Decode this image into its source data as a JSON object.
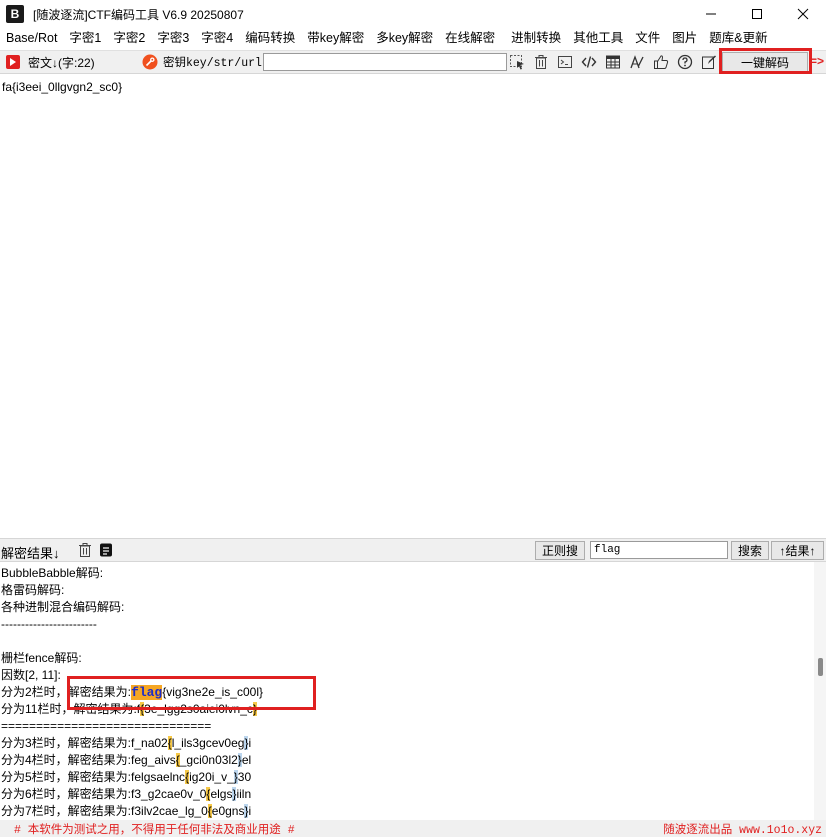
{
  "window": {
    "logo": "B",
    "title": "[随波逐流]CTF编码工具 V6.9  20250807"
  },
  "menu": [
    "Base/Rot",
    "字密1",
    "字密2",
    "字密3",
    "字密4",
    "编码转换",
    "带key解密",
    "多key解密",
    "在线解密",
    "进制转换",
    "其他工具",
    "文件",
    "图片",
    "题库&更新"
  ],
  "toolbar": {
    "cipher_label": "密文↓(字:22)",
    "key_label": "密钥key/str/url:",
    "key_value": "",
    "decode_button": "一键解码",
    "arrow_tag": "=>"
  },
  "input": {
    "text": "fa{i3eei_0llgvgn2_sc0}"
  },
  "resultbar": {
    "label": "解密结果↓",
    "regex_button": "正则搜",
    "search_value": "flag",
    "search_button": "搜索",
    "result_up_button": "↑结果↑"
  },
  "output": {
    "lines": [
      "BubbleBabble解码:",
      "格雷码解码:",
      "各种进制混合编码解码:",
      "------------------------",
      "",
      "栅栏fence解码:",
      "因数[2, 11]:"
    ],
    "fence2": {
      "prefix": "分为2栏时，解密结果为:",
      "flag": "flag",
      "rest": "{vig3ne2e_is_c00l}"
    },
    "fence11": {
      "prefix": "分为11栏时，解密结果为:",
      "a": "f",
      "b": "{",
      "c": "3e_lgg2s0aiei0lvn_c",
      "d": "}"
    },
    "separator": "==============================",
    "fence_rows": [
      {
        "prefix": "分为3栏时，解密结果为:",
        "a": "f_na02",
        "b": "{",
        "c": "l_ils3gcev0eg",
        "d": "}",
        "e": "i"
      },
      {
        "prefix": "分为4栏时，解密结果为:",
        "a": "feg_aivs",
        "b": "{",
        "c": "_gci0n03l2",
        "d": "}",
        "e": "el"
      },
      {
        "prefix": "分为5栏时，解密结果为:",
        "a": "felgsaelnc",
        "b": "{",
        "c": "ig20i_v_",
        "d": "}",
        "e": "30"
      },
      {
        "prefix": "分为6栏时，解密结果为:",
        "a": "f3_g2cae0v_0",
        "b": "{",
        "c": "elgs",
        "d": "}",
        "e": "iiln"
      },
      {
        "prefix": "分为7栏时，解密结果为:",
        "a": "f3ilv2cae_lg_0",
        "b": "{",
        "c": "e0gns",
        "d": "}",
        "e": "i"
      }
    ]
  },
  "footer": {
    "left": "# 本软件为测试之用，不得用于任何非法及商业用途 #",
    "right": "随波逐流出品 www.1o1o.xyz"
  },
  "colors": {
    "highlight_box": "#e02020",
    "flag_bg": "#f5a623",
    "flag_text": "#1c2cc8",
    "brace_bg": "#f7c948"
  }
}
